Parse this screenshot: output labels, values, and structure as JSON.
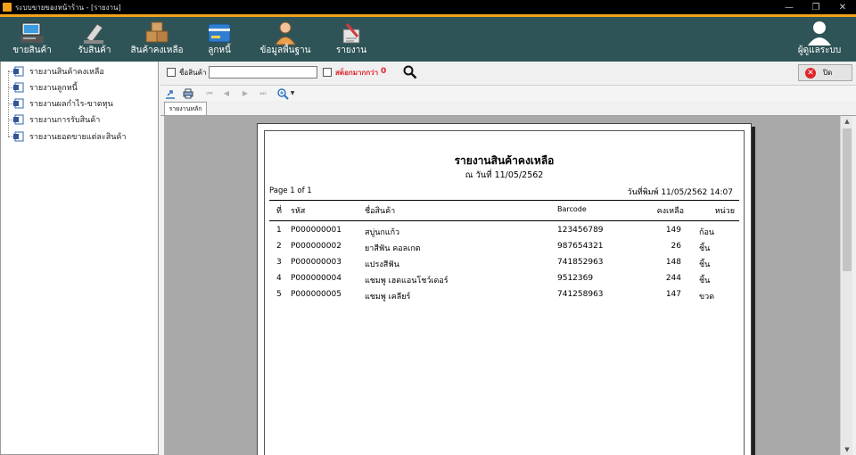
{
  "window": {
    "title": "ระบบขายของหน้าร้าน - [รายงาน]",
    "controls": {
      "minimize": "—",
      "maximize": "❐",
      "close": "✕"
    }
  },
  "ribbon": {
    "items": [
      {
        "label": "ขายสินค้า",
        "icon": "pos-terminal-icon"
      },
      {
        "label": "รับสินค้า",
        "icon": "receive-goods-icon"
      },
      {
        "label": "สินค้าคงเหลือ",
        "icon": "boxes-icon"
      },
      {
        "label": "ลูกหนี้",
        "icon": "credit-card-icon"
      },
      {
        "label": "ข้อมูลพื้นฐาน",
        "icon": "person-icon"
      },
      {
        "label": "รายงาน",
        "icon": "report-icon"
      }
    ],
    "user": {
      "label": "ผู้ดูแลระบบ",
      "icon": "user-icon"
    }
  },
  "tree": {
    "items": [
      "รายงานสินค้าคงเหลือ",
      "รายงานลูกหนี้",
      "รายงานผลกำไร-ขาดทุน",
      "รายงานการรับสินค้า",
      "รายงานยอดขายแต่ละสินค้า"
    ]
  },
  "filter": {
    "product_label": "ชื่อสินค้า",
    "product_value": "",
    "stock_label": "สต็อกมากกว่า",
    "stock_value": "0",
    "close_label": "ปิด"
  },
  "viewer": {
    "tab_label": "รายงานหลัก"
  },
  "report": {
    "title": "รายงานสินค้าคงเหลือ",
    "date_line": "ณ วันที่ 11/05/2562",
    "page_label": "Page 1 of 1",
    "print_label": "วันที่พิมพ์ 11/05/2562 14:07",
    "columns": {
      "no": "ที่",
      "code": "รหัส",
      "name": "ชื่อสินค้า",
      "barcode": "Barcode",
      "qty": "คงเหลือ",
      "unit": "หน่วย"
    },
    "rows": [
      {
        "no": "1",
        "code": "P000000001",
        "name": "สบู่นกแก้ว",
        "barcode": "123456789",
        "qty": "149",
        "unit": "ก้อน"
      },
      {
        "no": "2",
        "code": "P000000002",
        "name": "ยาสีฟัน คอลเกต",
        "barcode": "987654321",
        "qty": "26",
        "unit": "ชิ้น"
      },
      {
        "no": "3",
        "code": "P000000003",
        "name": "แปรงสีฟัน",
        "barcode": "741852963",
        "qty": "148",
        "unit": "ชิ้น"
      },
      {
        "no": "4",
        "code": "P000000004",
        "name": "แชมพู เฮดแอนโชว์เดอร์",
        "barcode": "9512369",
        "qty": "244",
        "unit": "ชิ้น"
      },
      {
        "no": "5",
        "code": "P000000005",
        "name": "แชมพู เคลียร์",
        "barcode": "741258963",
        "qty": "147",
        "unit": "ขวด"
      }
    ]
  },
  "colors": {
    "ribbon": "#2f5457",
    "accent": "#f3a11b",
    "close_icon": "#e0242a",
    "stock_label": "#e0242a"
  }
}
